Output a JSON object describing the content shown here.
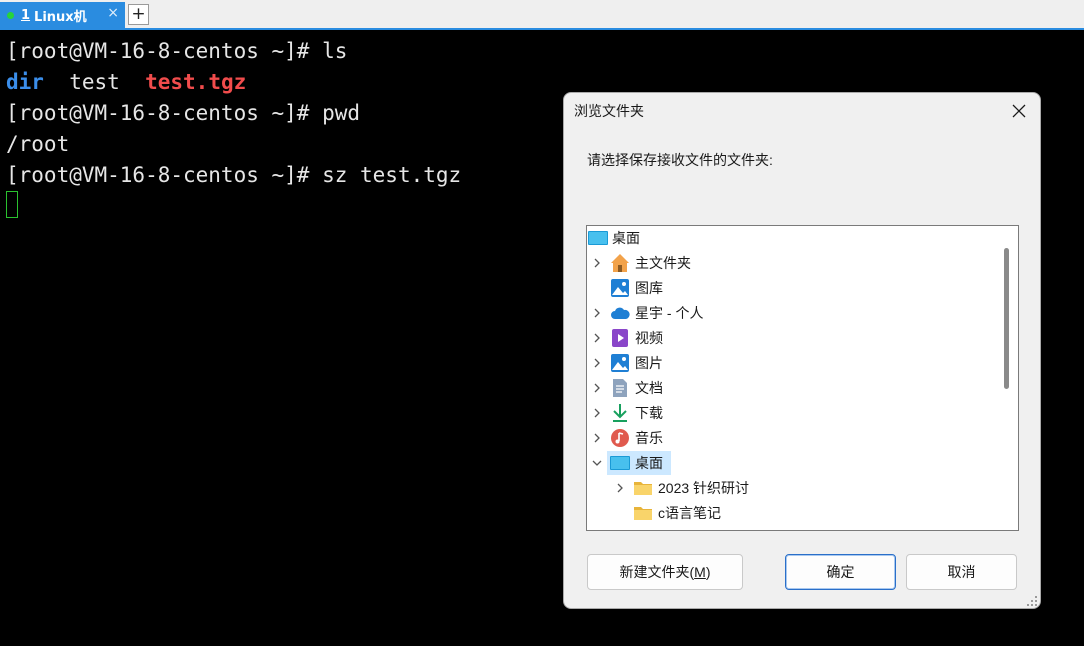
{
  "tabbar": {
    "tab": {
      "number": "1",
      "title": "Linux机",
      "close": "×",
      "status_color": "#27d43a"
    },
    "add": "+"
  },
  "terminal": {
    "lines": [
      {
        "prompt": "[root@VM-16-8-centos ~]#",
        "command": " ls"
      },
      {
        "ls_dir": "dir",
        "ls_file": "test",
        "ls_tgz": "test.tgz"
      },
      {
        "prompt": "[root@VM-16-8-centos ~]#",
        "command": " pwd"
      },
      {
        "output": "/root"
      },
      {
        "prompt": "[root@VM-16-8-centos ~]#",
        "command": " sz test.tgz"
      }
    ],
    "colors": {
      "dir": "#3b8eea",
      "archive": "#f14c4c",
      "cursor": "#2ac12f"
    }
  },
  "dialog": {
    "title": "浏览文件夹",
    "prompt": "请选择保存接收文件的文件夹:",
    "tree": [
      {
        "label": "桌面",
        "icon": "desktop-icon",
        "expand": "none"
      },
      {
        "label": "主文件夹",
        "icon": "home-icon",
        "expand": "collapsed"
      },
      {
        "label": "图库",
        "icon": "gallery-icon",
        "expand": "none"
      },
      {
        "label": "星宇 - 个人",
        "icon": "onedrive-cloud-icon",
        "expand": "collapsed"
      },
      {
        "label": "视频",
        "icon": "videos-icon",
        "expand": "collapsed"
      },
      {
        "label": "图片",
        "icon": "pictures-icon",
        "expand": "collapsed"
      },
      {
        "label": "文档",
        "icon": "documents-icon",
        "expand": "collapsed"
      },
      {
        "label": "下载",
        "icon": "downloads-icon",
        "expand": "collapsed"
      },
      {
        "label": "音乐",
        "icon": "music-icon",
        "expand": "collapsed"
      },
      {
        "label": "桌面",
        "icon": "desktop-icon",
        "expand": "expanded",
        "selected": true
      },
      {
        "label": "2023 针织研讨",
        "icon": "folder-icon",
        "expand": "collapsed"
      },
      {
        "label": "c语言笔记",
        "icon": "folder-icon",
        "expand": "none"
      }
    ],
    "buttons": {
      "new_folder_text": "新建文件夹(",
      "new_folder_key": "M",
      "new_folder_end": ")",
      "ok": "确定",
      "cancel": "取消"
    }
  }
}
